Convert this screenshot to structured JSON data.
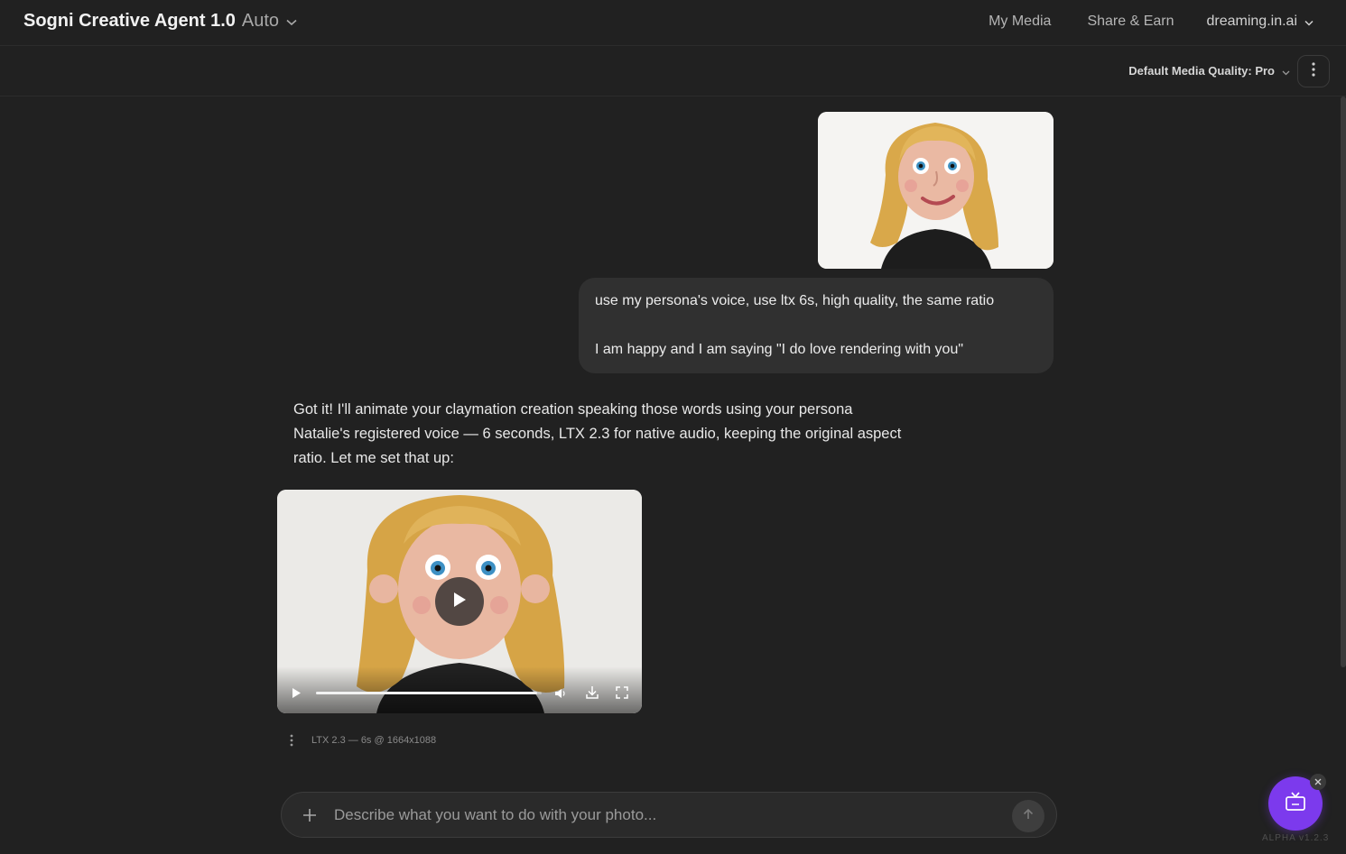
{
  "header": {
    "brand_name": "Sogni Creative Agent 1.0",
    "mode": "Auto",
    "nav": [
      {
        "label": "My Media"
      },
      {
        "label": "Share & Earn"
      }
    ],
    "account": "dreaming.in.ai"
  },
  "subheader": {
    "quality_label": "Default Media Quality: Pro"
  },
  "conversation": {
    "user_message": {
      "line1": "use my persona's voice, use ltx 6s, high quality, the same ratio",
      "line2": "I am happy and I am saying \"I do love rendering with you\""
    },
    "assistant_message": "Got it! I'll animate your claymation creation speaking those words using your persona Natalie's registered voice — 6 seconds, LTX 2.3 for native audio, keeping the original aspect ratio. Let me set that up:",
    "video": {
      "progress": 0.98,
      "meta": "LTX 2.3 — 6s @ 1664x1088"
    }
  },
  "composer": {
    "placeholder": "Describe what you want to do with your photo..."
  },
  "footer": {
    "version": "ALPHA v1.2.3"
  },
  "colors": {
    "background": "#212121",
    "bubble": "#303030",
    "accent": "#7c3aed"
  },
  "icons": [
    "chevron-down-icon",
    "more-vertical-icon",
    "play-icon",
    "volume-icon",
    "download-icon",
    "fullscreen-icon",
    "plus-icon",
    "arrow-up-icon",
    "tv-icon",
    "close-icon"
  ]
}
